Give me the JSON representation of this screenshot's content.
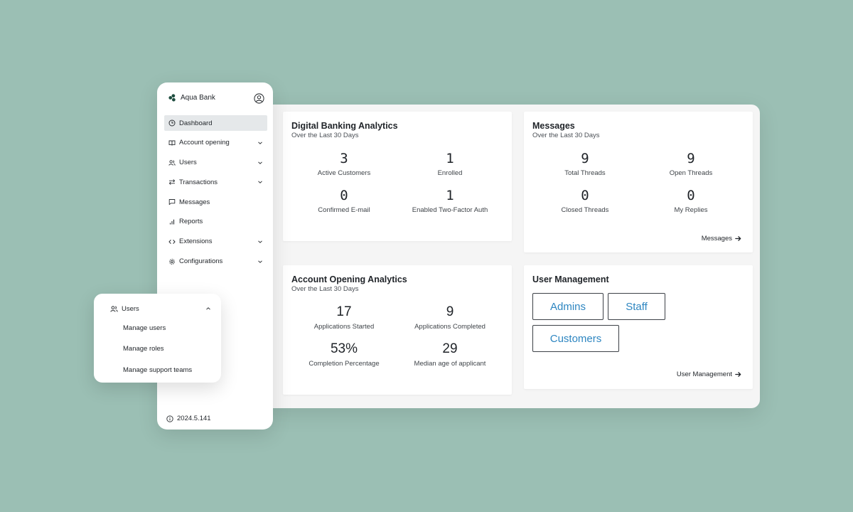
{
  "sidebar": {
    "brand": "Aqua Bank",
    "items": [
      {
        "label": "Dashboard",
        "icon": "clock-icon",
        "active": true,
        "has_chevron": false
      },
      {
        "label": "Account opening",
        "icon": "book-icon",
        "active": false,
        "has_chevron": true
      },
      {
        "label": "Users",
        "icon": "users-icon",
        "active": false,
        "has_chevron": true
      },
      {
        "label": "Transactions",
        "icon": "arrows-icon",
        "active": false,
        "has_chevron": true
      },
      {
        "label": "Messages",
        "icon": "message-icon",
        "active": false,
        "has_chevron": false
      },
      {
        "label": "Reports",
        "icon": "bar-chart-icon",
        "active": false,
        "has_chevron": false
      },
      {
        "label": "Extensions",
        "icon": "code-icon",
        "active": false,
        "has_chevron": true
      },
      {
        "label": "Configurations",
        "icon": "gear-icon",
        "active": false,
        "has_chevron": true
      }
    ],
    "version": "2024.5.141"
  },
  "users_popover": {
    "title": "Users",
    "items": [
      "Manage users",
      "Manage roles",
      "Manage support teams"
    ]
  },
  "digital_banking": {
    "title": "Digital Banking Analytics",
    "subtitle": "Over the Last 30 Days",
    "stats": [
      {
        "value": "3",
        "label": "Active Customers"
      },
      {
        "value": "1",
        "label": "Enrolled"
      },
      {
        "value": "0",
        "label": "Confirmed E-mail"
      },
      {
        "value": "1",
        "label": "Enabled Two-Factor Auth"
      }
    ]
  },
  "messages": {
    "title": "Messages",
    "subtitle": "Over the Last 30 Days",
    "stats": [
      {
        "value": "9",
        "label": "Total Threads"
      },
      {
        "value": "9",
        "label": "Open Threads"
      },
      {
        "value": "0",
        "label": "Closed Threads"
      },
      {
        "value": "0",
        "label": "My Replies"
      }
    ],
    "link": "Messages"
  },
  "account_opening": {
    "title": "Account Opening Analytics",
    "subtitle": "Over the Last 30 Days",
    "stats": [
      {
        "value": "17",
        "label": "Applications Started"
      },
      {
        "value": "9",
        "label": "Applications Completed"
      },
      {
        "value": "53%",
        "label": "Completion Percentage"
      },
      {
        "value": "29",
        "label": "Median age of applicant"
      }
    ]
  },
  "user_management": {
    "title": "User Management",
    "buttons": [
      "Admins",
      "Staff",
      "Customers"
    ],
    "link": "User Management"
  },
  "colors": {
    "background": "#9bbfb4",
    "accent_text": "#2e86c1",
    "brand_green": "#1e4d3f",
    "active_nav": "#e5e8ea"
  }
}
